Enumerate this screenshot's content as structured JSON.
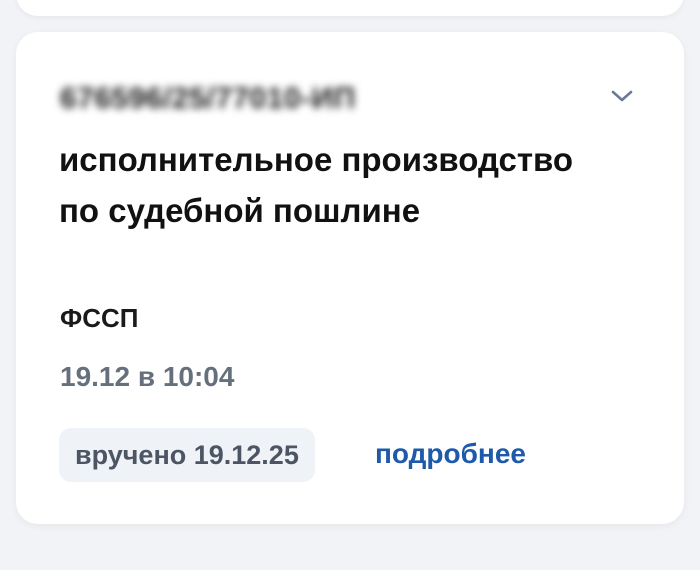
{
  "notification": {
    "case_number": "676596/25/77010-ИП",
    "title": "исполнительное производство по судебной пошлине",
    "sender": "ФССП",
    "datetime": "19.12 в 10:04",
    "status": "вручено 19.12.25",
    "more_label": "подробнее",
    "expand_icon": "chevron-down-icon"
  },
  "colors": {
    "background": "#f1f3f6",
    "card": "#ffffff",
    "title_text": "#111111",
    "muted_text": "#66707d",
    "badge_bg": "#eff2f7",
    "link": "#1e5aa9",
    "chevron": "#6b7a99"
  }
}
